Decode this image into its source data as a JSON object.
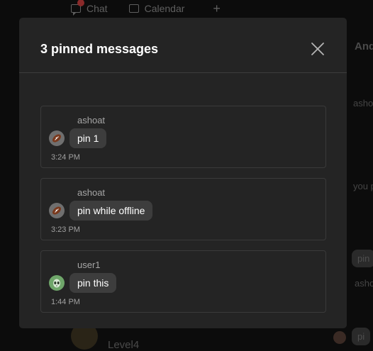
{
  "background": {
    "tabs": [
      {
        "label": "Chat",
        "icon": "chat-icon"
      },
      {
        "label": "Calendar",
        "icon": "calendar-icon"
      }
    ],
    "add_tab_symbol": "+",
    "right_panel": {
      "header_fragment": "And",
      "text_fragments": [
        "asho",
        "you p",
        "asho"
      ],
      "pill_fragments": [
        "pin",
        "pi"
      ]
    },
    "bottom_label": "Level4"
  },
  "modal": {
    "title": "3 pinned messages",
    "close_icon": "close-icon",
    "messages": [
      {
        "author": "ashoat",
        "text": "pin 1",
        "time": "3:24 PM",
        "avatar": "football-emoji-avatar"
      },
      {
        "author": "ashoat",
        "text": "pin while offline",
        "time": "3:23 PM",
        "avatar": "football-emoji-avatar"
      },
      {
        "author": "user1",
        "text": "pin this",
        "time": "1:44 PM",
        "avatar": "alien-emoji-avatar"
      }
    ]
  },
  "colors": {
    "overlay": "#0c0c0c",
    "modal_bg": "#242424",
    "bubble_bg": "#3d3d3d",
    "text_primary": "#ffffff",
    "text_secondary": "#a6a6a6"
  }
}
